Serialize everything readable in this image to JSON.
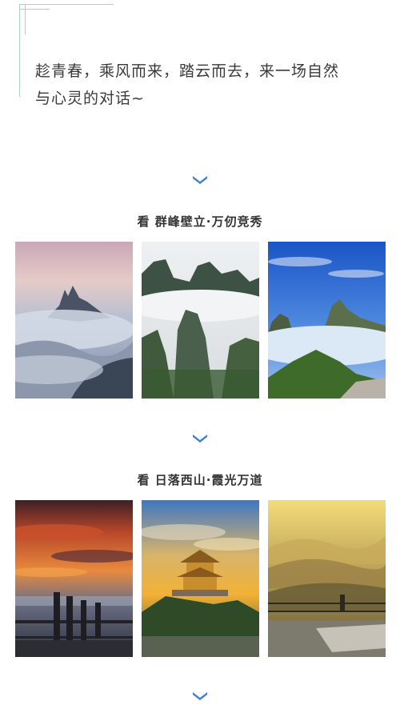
{
  "intro": {
    "line1": "趁青春，乘风而来，踏云而去，来一场自然",
    "line2": "与心灵的对话~"
  },
  "section1": {
    "title": "看 群峰壁立·万仞竞秀"
  },
  "section2": {
    "title": "看 日落西山·霞光万道"
  },
  "colors": {
    "accent": "#3b7fd4",
    "corner": "#a9cde8",
    "title_text": "#333333"
  },
  "icons": {
    "chevron": "chevron-down-icon"
  }
}
